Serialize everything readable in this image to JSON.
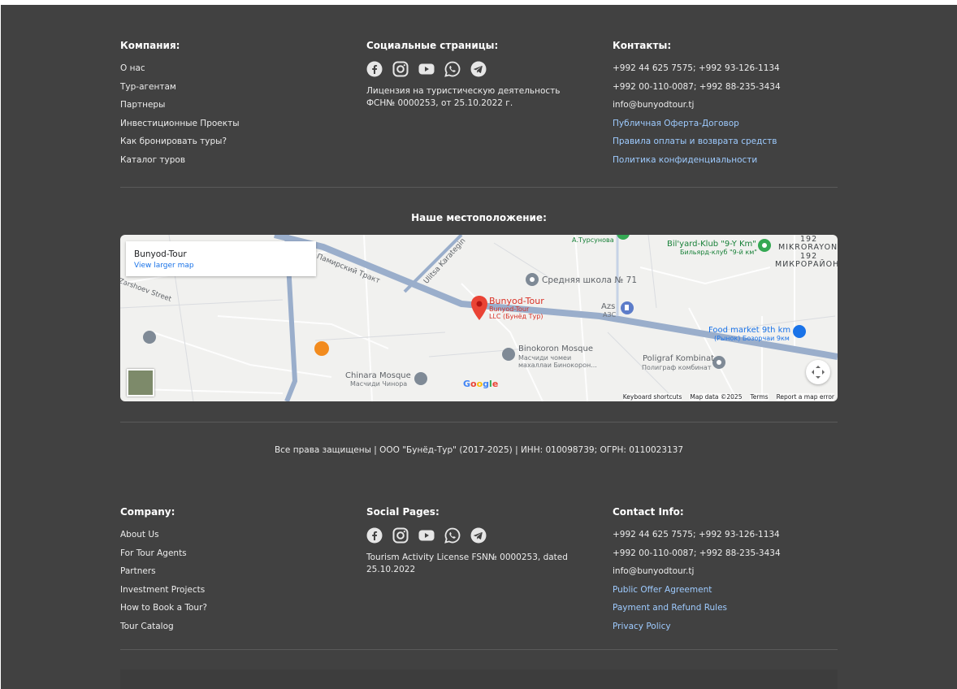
{
  "ru": {
    "company": {
      "heading": "Компания:",
      "links": [
        "О нас",
        "Тур-агентам",
        "Партнеры",
        "Инвестиционные Проекты",
        "Как бронировать туры?",
        "Каталог туров"
      ]
    },
    "social": {
      "heading": "Социальные страницы:",
      "license": "Лицензия на туристическую деятельность ФСН№ 0000253, от 25.10.2022 г."
    },
    "contacts": {
      "heading": "Контакты:",
      "phone1": "+992 44 625 7575; +992 93-126-1134",
      "phone2": "+992 00-110-0087; +992 88-235-3434",
      "email": "info@bunyodtour.tj",
      "links": [
        "Публичная Оферта-Договор",
        "Правила оплаты и возврата средств",
        "Политика конфиденциальности"
      ]
    }
  },
  "location": {
    "title": "Наше местоположение:",
    "card_title": "Bunyod-Tour",
    "card_link": "View larger map",
    "labels": {
      "bunyod": "Bunyod-Tour",
      "bunyod_sub1": "Bunyod-Tour",
      "bunyod_sub2": "LLC (Бунёд Тур)",
      "school": "Средняя школа № 71",
      "bil": "Bil'yard-Klub \"9-Y Km\"",
      "bil_sub": "Бильярд-клуб \"9-й км\"",
      "mikro1": "192",
      "mikro2": "MIKRORAYON",
      "mikro3": "192",
      "mikro4": "МИКРОРАЙОН",
      "turs": "А.Турсунова",
      "azs": "Azs",
      "azs_sub": "АЗС",
      "food": "Food market 9th km",
      "food_sub": "(Рынок) Бозорчаи 9км",
      "binok": "Binokoron Mosque",
      "binok_sub1": "Масчиди чомеи",
      "binok_sub2": "махаллаи Бинокорон...",
      "poli": "Poligraf Kombinat",
      "poli_sub": "Полиграф комбинат",
      "chin": "Chinara Mosque",
      "chin_sub": "Масчиди Чинора",
      "pamir": "Памирский Тракт",
      "karat": "Ulitsa Karategin",
      "zars": "Zarshoev Street"
    },
    "google": "Google",
    "footer": [
      "Keyboard shortcuts",
      "Map data ©2025",
      "Terms",
      "Report a map error"
    ]
  },
  "copyright": "Все права защищены | ООО \"Бунёд-Тур\" (2017-2025) | ИНН: 010098739; ОГРН: 0110023137",
  "en": {
    "company": {
      "heading": "Company:",
      "links": [
        "About Us",
        "For Tour Agents",
        "Partners",
        "Investment Projects",
        "How to Book a Tour?",
        "Tour Catalog"
      ]
    },
    "social": {
      "heading": "Social Pages:",
      "license": "Tourism Activity License FSN№ 0000253, dated 25.10.2022"
    },
    "contacts": {
      "heading": "Contact Info:",
      "phone1": "+992 44 625 7575; +992 93-126-1134",
      "phone2": "+992 00-110-0087; +992 88-235-3434",
      "email": "info@bunyodtour.tj",
      "links": [
        "Public Offer Agreement",
        "Payment and Refund Rules",
        "Privacy Policy"
      ]
    }
  },
  "colors": {
    "background": "#414141",
    "link_blue": "#9ecbff",
    "divider": "#5a5a5a"
  },
  "icons": [
    "facebook-icon",
    "instagram-icon",
    "youtube-icon",
    "whatsapp-icon",
    "telegram-icon"
  ]
}
